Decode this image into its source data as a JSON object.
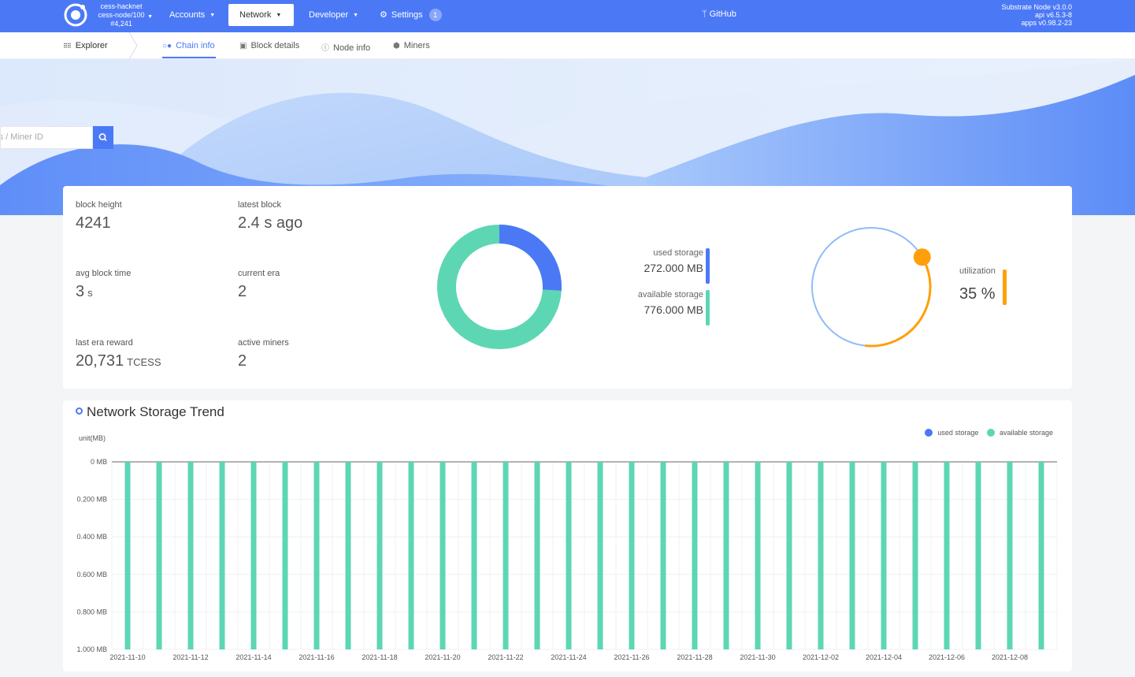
{
  "topbar": {
    "chain": {
      "name": "cess-hacknet",
      "node": "cess-node/100",
      "block": "#4,241"
    },
    "menus": {
      "accounts": "Accounts",
      "network": "Network",
      "developer": "Developer",
      "settings": "Settings",
      "settings_badge": "1"
    },
    "github": "GitHub",
    "versions": {
      "node": "Substrate Node v3.0.0",
      "api": "api v6.5.3-8",
      "apps": "apps v0.98.2-23"
    }
  },
  "subnav": {
    "explorer": "Explorer",
    "tabs": {
      "chain_info": "Chain info",
      "block_details": "Block details",
      "node_info": "Node info",
      "miners": "Miners"
    }
  },
  "search": {
    "placeholder": "ess /  Miner ID"
  },
  "stats": {
    "block_height": {
      "label": "block height",
      "value": "4241"
    },
    "latest_block": {
      "label": "latest block",
      "value": "2.4 s ago"
    },
    "avg_block_time": {
      "label": "avg block time",
      "value": "3",
      "unit": "s"
    },
    "current_era": {
      "label": "current era",
      "value": "2"
    },
    "last_era_reward": {
      "label": "last era reward",
      "value": "20,731",
      "unit": "TCESS"
    },
    "active_miners": {
      "label": "active miners",
      "value": "2"
    }
  },
  "storage": {
    "used": {
      "label": "used storage",
      "value": "272.000 MB",
      "mb": 272
    },
    "available": {
      "label": "available storage",
      "value": "776.000 MB",
      "mb": 776
    },
    "colors": {
      "used": "#4b79f6",
      "available": "#5dd6b4"
    }
  },
  "utilization": {
    "label": "utilization",
    "value": "35 %",
    "percent": 35,
    "color": "#ff9f0a",
    "ring_color": "#8fbcf6"
  },
  "trend": {
    "title": "Network Storage Trend",
    "unit_label": "unit(MB)",
    "legend": {
      "used": "used storage",
      "available": "available storage"
    }
  },
  "chart_data": {
    "type": "bar",
    "title": "Network Storage Trend",
    "ylabel": "unit(MB)",
    "y_ticks": [
      "0 MB",
      "0.200 MB",
      "0.400 MB",
      "0.600 MB",
      "0.800 MB",
      "1.000 MB"
    ],
    "ylim": [
      0,
      1
    ],
    "y_inverted": true,
    "x_ticks": [
      "2021-11-10",
      "2021-11-12",
      "2021-11-14",
      "2021-11-16",
      "2021-11-18",
      "2021-11-20",
      "2021-11-22",
      "2021-11-24",
      "2021-11-26",
      "2021-11-28",
      "2021-11-30",
      "2021-12-02",
      "2021-12-04",
      "2021-12-06",
      "2021-12-08"
    ],
    "categories": [
      "2021-11-10",
      "2021-11-11",
      "2021-11-12",
      "2021-11-13",
      "2021-11-14",
      "2021-11-15",
      "2021-11-16",
      "2021-11-17",
      "2021-11-18",
      "2021-11-19",
      "2021-11-20",
      "2021-11-21",
      "2021-11-22",
      "2021-11-23",
      "2021-11-24",
      "2021-11-25",
      "2021-11-26",
      "2021-11-27",
      "2021-11-28",
      "2021-11-29",
      "2021-11-30",
      "2021-12-01",
      "2021-12-02",
      "2021-12-03",
      "2021-12-04",
      "2021-12-05",
      "2021-12-06",
      "2021-12-07",
      "2021-12-08",
      "2021-12-09"
    ],
    "series": [
      {
        "name": "used storage",
        "color": "#4b79f6",
        "values": [
          0,
          0,
          0,
          0,
          0,
          0,
          0,
          0,
          0,
          0,
          0,
          0,
          0,
          0,
          0,
          0,
          0,
          0,
          0,
          0,
          0,
          0,
          0,
          0,
          0,
          0,
          0,
          0,
          0,
          0
        ]
      },
      {
        "name": "available storage",
        "color": "#5dd6b4",
        "values": [
          1,
          1,
          1,
          1,
          1,
          1,
          1,
          1,
          1,
          1,
          1,
          1,
          1,
          1,
          1,
          1,
          1,
          1,
          1,
          1,
          1,
          1,
          1,
          1,
          1,
          1,
          1,
          1,
          1,
          1
        ]
      }
    ],
    "grid": true,
    "legend": "top-right"
  }
}
